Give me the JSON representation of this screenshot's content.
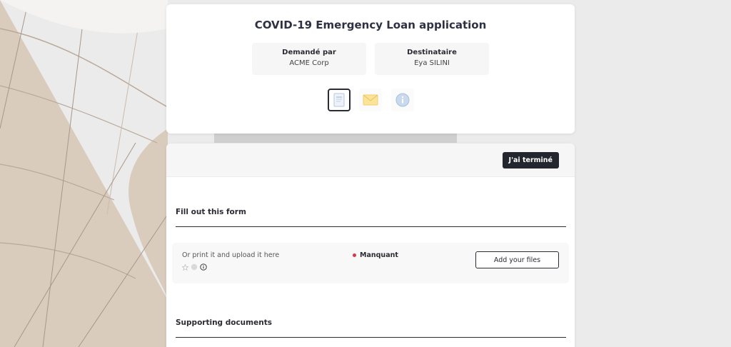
{
  "header": {
    "title": "COVID-19 Emergency Loan application",
    "requested_by_label": "Demandé par",
    "requested_by_value": "ACME Corp",
    "recipient_label": "Destinataire",
    "recipient_value": "Eya SILINI"
  },
  "tabs": [
    {
      "icon": "document-icon",
      "active": true
    },
    {
      "icon": "envelope-icon",
      "active": false
    },
    {
      "icon": "info-icon",
      "active": false
    }
  ],
  "toolbar": {
    "done_label": "J'ai terminé"
  },
  "sections": {
    "form": {
      "title": "Fill out this form",
      "item_label": "Or print it and upload it here",
      "status": "Manquant",
      "status_color": "#e0344b",
      "add_files_label": "Add your files"
    },
    "supporting": {
      "title": "Supporting documents"
    }
  },
  "colors": {
    "primary_dark": "#23262e",
    "card_bg": "#ffffff",
    "muted_bg": "#f6f6f7"
  }
}
